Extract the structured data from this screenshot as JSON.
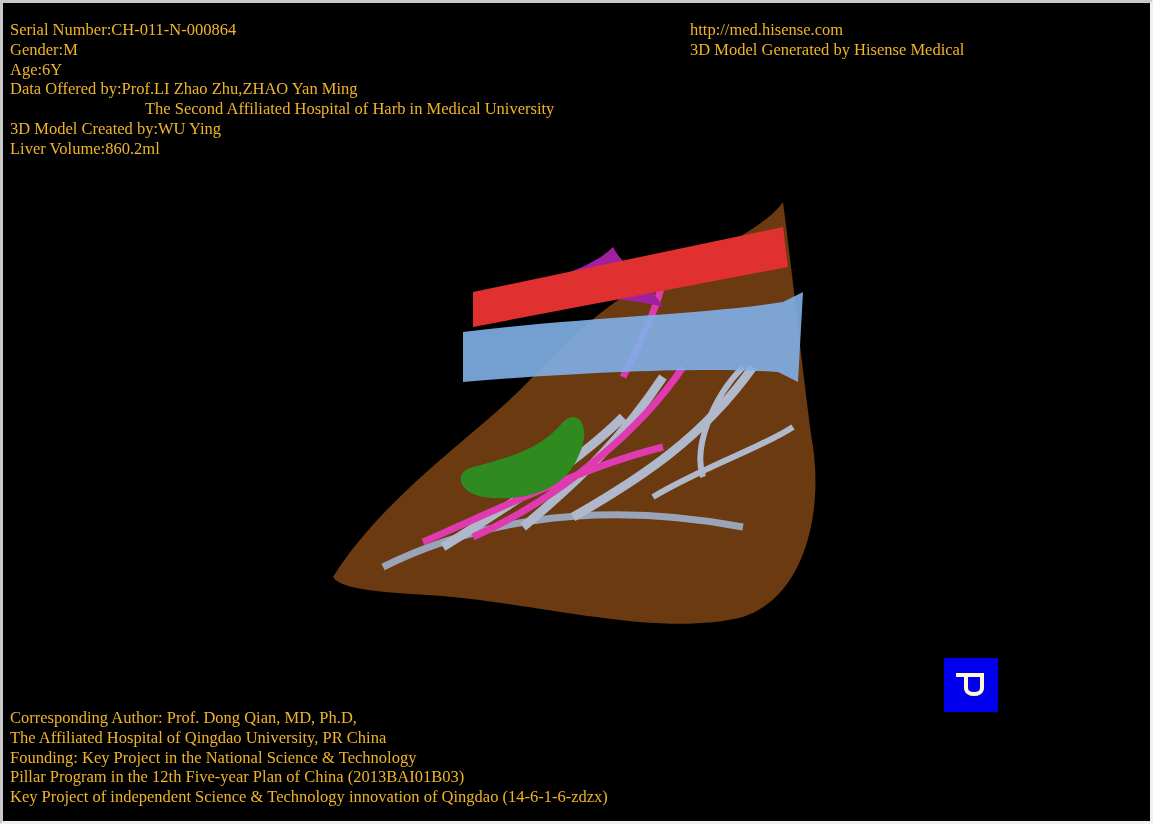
{
  "patient_info": [
    {
      "kind": "line",
      "text": "Serial Number:CH-011-N-000864"
    },
    {
      "kind": "line",
      "text": "Gender:M"
    },
    {
      "kind": "line",
      "text": "Age:6Y"
    },
    {
      "kind": "line",
      "text": "Data Offered by:Prof.LI Zhao Zhu,ZHAO Yan Ming"
    },
    {
      "kind": "continuation",
      "text": "The Second Affiliated Hospital of Harb in Medical University"
    },
    {
      "kind": "line",
      "text": "3D Model Created by:WU Ying"
    },
    {
      "kind": "line",
      "text": "Liver Volume:860.2ml"
    }
  ],
  "header_right": [
    "http://med.hisense.com",
    "3D Model Generated by Hisense Medical"
  ],
  "credits": [
    "Corresponding Author: Prof. Dong Qian, MD, Ph.D,",
    "The Affiliated Hospital of Qingdao University, PR China",
    "Founding: Key Project in the National Science & Technology",
    "Pillar Program in the 12th Five-year Plan of China (2013BAI01B03)",
    "Key Project of independent Science & Technology innovation of Qingdao (14-6-1-6-zdzx)"
  ]
}
